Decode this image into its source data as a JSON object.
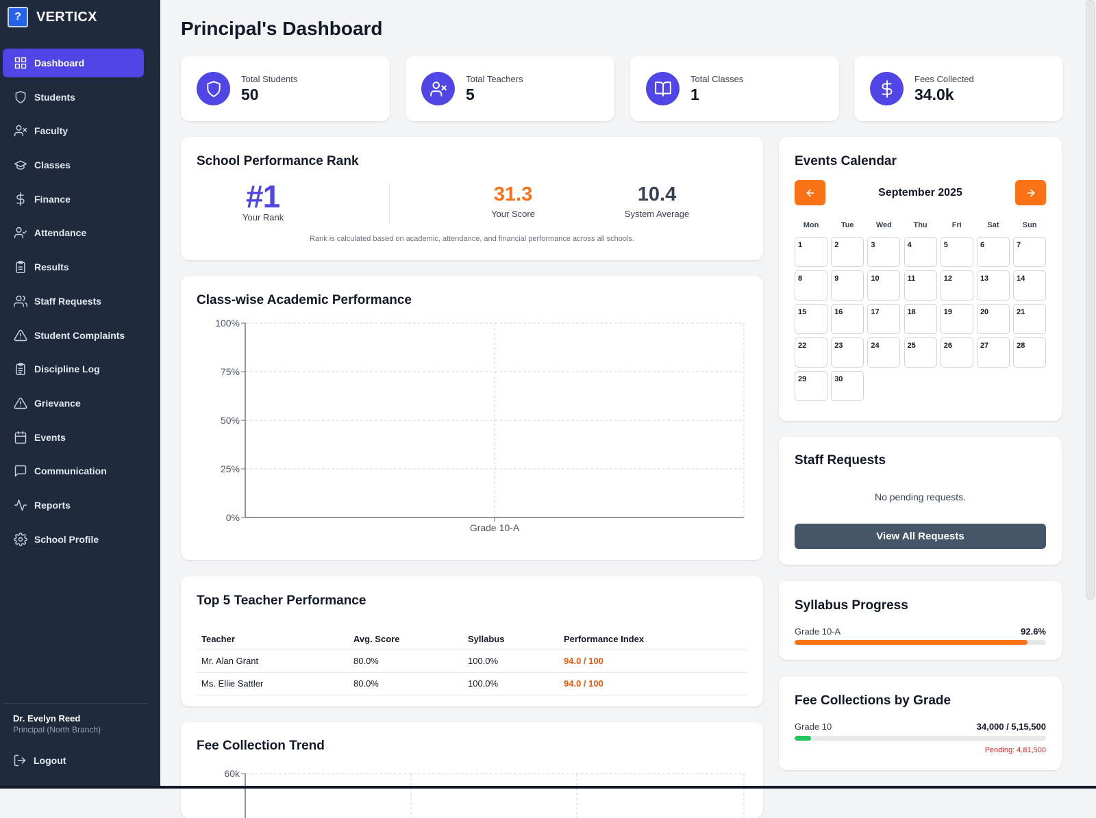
{
  "brand": {
    "name": "VERTICX",
    "logo_icon": "help-icon"
  },
  "sidebar": {
    "items": [
      {
        "label": "Dashboard",
        "icon": "grid-icon",
        "active": true
      },
      {
        "label": "Students",
        "icon": "shield-icon"
      },
      {
        "label": "Faculty",
        "icon": "user-x-icon"
      },
      {
        "label": "Classes",
        "icon": "graduation-cap-icon"
      },
      {
        "label": "Finance",
        "icon": "dollar-icon"
      },
      {
        "label": "Attendance",
        "icon": "user-check-icon"
      },
      {
        "label": "Results",
        "icon": "clipboard-icon"
      },
      {
        "label": "Staff Requests",
        "icon": "users-icon"
      },
      {
        "label": "Student Complaints",
        "icon": "alert-triangle-icon"
      },
      {
        "label": "Discipline Log",
        "icon": "clipboard-list-icon"
      },
      {
        "label": "Grievance",
        "icon": "alert-triangle-icon"
      },
      {
        "label": "Events",
        "icon": "calendar-icon"
      },
      {
        "label": "Communication",
        "icon": "message-square-icon"
      },
      {
        "label": "Reports",
        "icon": "activity-icon"
      },
      {
        "label": "School Profile",
        "icon": "settings-icon"
      }
    ],
    "user": {
      "name": "Dr. Evelyn Reed",
      "role": "Principal (North Branch)"
    },
    "logout_label": "Logout"
  },
  "page": {
    "title": "Principal's Dashboard"
  },
  "stats": [
    {
      "label": "Total Students",
      "value": "50",
      "icon": "shield-icon"
    },
    {
      "label": "Total Teachers",
      "value": "5",
      "icon": "user-x-icon"
    },
    {
      "label": "Total Classes",
      "value": "1",
      "icon": "book-open-icon"
    },
    {
      "label": "Fees Collected",
      "value": "34.0k",
      "icon": "dollar-icon"
    }
  ],
  "rank": {
    "title": "School Performance Rank",
    "rank": "#1",
    "rank_label": "Your Rank",
    "score": "31.3",
    "score_label": "Your Score",
    "average": "10.4",
    "average_label": "System Average",
    "note": "Rank is calculated based on academic, attendance, and financial performance across all schools."
  },
  "class_performance": {
    "title": "Class-wise Academic Performance"
  },
  "fee_trend": {
    "title": "Fee Collection Trend"
  },
  "chart_data": [
    {
      "type": "bar",
      "title": "Class-wise Academic Performance",
      "categories": [
        "Grade 10-A"
      ],
      "values": [
        0
      ],
      "ylim": [
        0,
        100
      ],
      "yticks": [
        "0%",
        "25%",
        "50%",
        "75%",
        "100%"
      ],
      "grid": true
    },
    {
      "type": "line",
      "title": "Fee Collection Trend",
      "yticks": [
        "60k"
      ],
      "grid": true
    }
  ],
  "teachers": {
    "title": "Top 5 Teacher Performance",
    "columns": [
      "Teacher",
      "Avg. Score",
      "Syllabus",
      "Performance Index"
    ],
    "rows": [
      [
        "Mr. Alan Grant",
        "80.0%",
        "100.0%",
        "94.0 / 100"
      ],
      [
        "Ms. Ellie Sattler",
        "80.0%",
        "100.0%",
        "94.0 / 100"
      ]
    ]
  },
  "calendar": {
    "title": "Events Calendar",
    "month": "September 2025",
    "weekdays": [
      "Mon",
      "Tue",
      "Wed",
      "Thu",
      "Fri",
      "Sat",
      "Sun"
    ],
    "days": [
      "1",
      "2",
      "3",
      "4",
      "5",
      "6",
      "7",
      "8",
      "9",
      "10",
      "11",
      "12",
      "13",
      "14",
      "15",
      "16",
      "17",
      "18",
      "19",
      "20",
      "21",
      "22",
      "23",
      "24",
      "25",
      "26",
      "27",
      "28",
      "29",
      "30"
    ],
    "prev_icon": "arrow-left-icon",
    "next_icon": "arrow-right-icon"
  },
  "staff_requests": {
    "title": "Staff Requests",
    "empty_text": "No pending requests.",
    "button_label": "View All Requests"
  },
  "syllabus": {
    "title": "Syllabus Progress",
    "items": [
      {
        "label": "Grade 10-A",
        "value": "92.6%",
        "fraction": 0.926
      }
    ]
  },
  "fee_by_grade": {
    "title": "Fee Collections by Grade",
    "items": [
      {
        "label": "Grade 10",
        "value": "34,000 / 5,15,500",
        "pending": "Pending: 4,81,500",
        "fraction": 0.066
      }
    ]
  },
  "colors": {
    "primary": "#4f46e5",
    "accent": "#f97316",
    "sidebar": "#1f2a3c",
    "success": "#22c55e",
    "danger": "#dc2626"
  }
}
